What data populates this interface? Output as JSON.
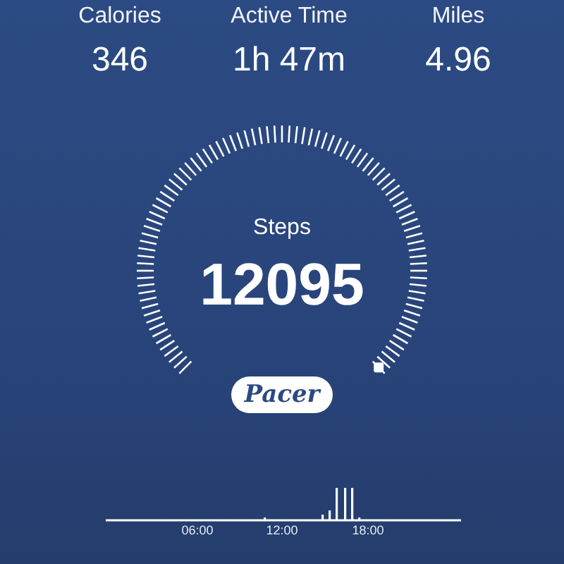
{
  "stats": [
    {
      "label": "Calories",
      "value": "346"
    },
    {
      "label": "Active Time",
      "value": "1h 47m"
    },
    {
      "label": "Miles",
      "value": "4.96"
    }
  ],
  "dial": {
    "label": "Steps",
    "value": "12095"
  },
  "logo_button": {
    "label": "Pacer"
  },
  "activity_chart": {
    "time_labels": [
      "06:00",
      "12:00",
      "18:00"
    ]
  }
}
